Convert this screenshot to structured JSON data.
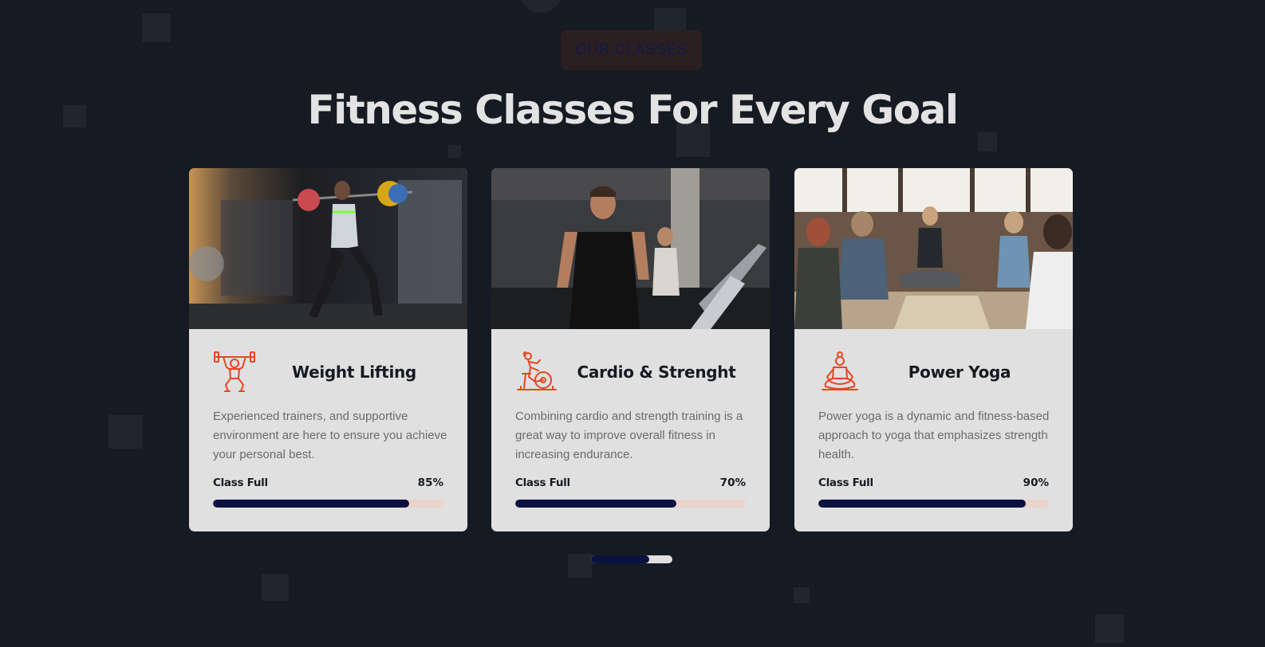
{
  "section": {
    "eyebrow": "OUR CLASSES",
    "title": "Fitness Classes For Every Goal"
  },
  "colors": {
    "accent": "#e8461f",
    "progress_fill": "#0b1140",
    "progress_track": "#ecd3cb",
    "card_bg": "#e0e0e0",
    "page_bg": "#161b23"
  },
  "classes": [
    {
      "title": "Weight Lifting",
      "icon": "weightlifter-icon",
      "description": "Experienced trainers, and supportive environment are here to ensure you achieve your personal best.",
      "progress_label": "Class Full",
      "progress_text": "85%",
      "progress": 0.85
    },
    {
      "title": "Cardio & Strenght",
      "icon": "exercise-bike-icon",
      "description": "Combining cardio and strength training is a great way to improve overall fitness in increasing endurance.",
      "progress_label": "Class Full",
      "progress_text": "70%",
      "progress": 0.7
    },
    {
      "title": "Power Yoga",
      "icon": "yoga-pose-icon",
      "description": "Power yoga is a dynamic and fitness-based approach to yoga that emphasizes strength health.",
      "progress_label": "Class Full",
      "progress_text": "90%",
      "progress": 0.9
    }
  ],
  "carousel": {
    "progress": 0.72
  }
}
